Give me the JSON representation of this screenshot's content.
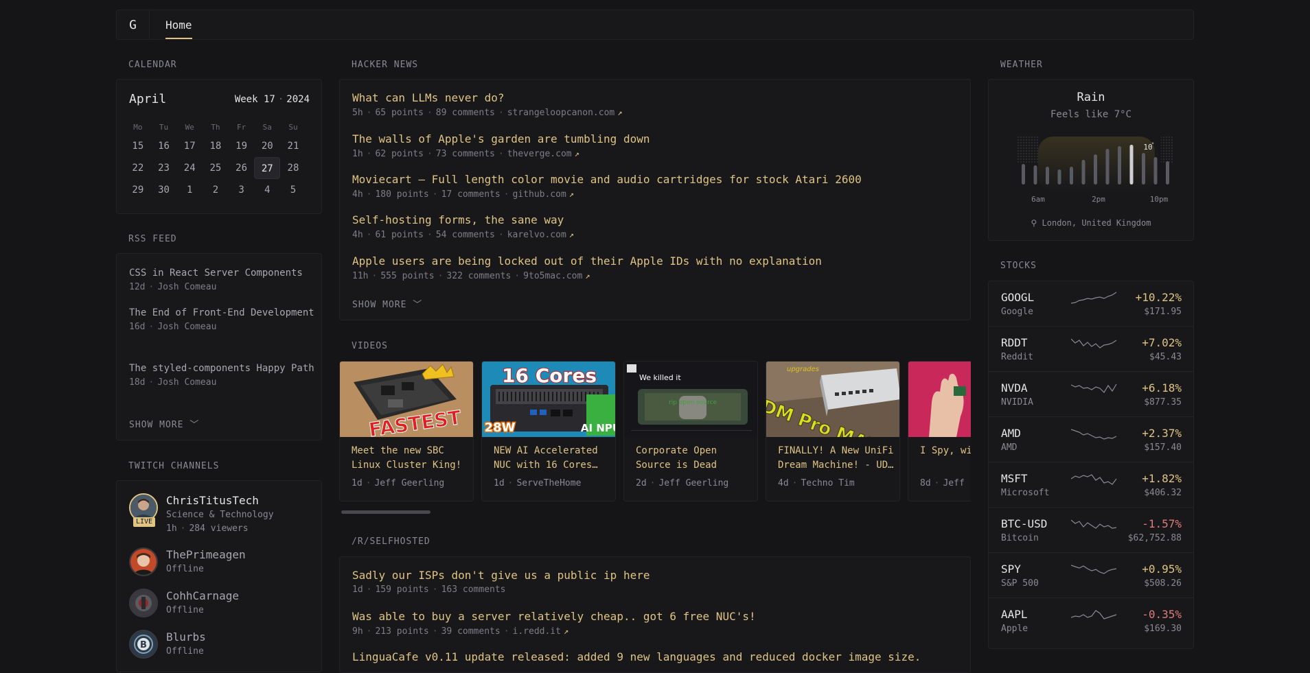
{
  "nav": {
    "logo": "G",
    "home": "Home"
  },
  "calendar": {
    "section": "CALENDAR",
    "month": "April",
    "week_label": "Week 17",
    "year": "2024",
    "weekdays": [
      "Mo",
      "Tu",
      "We",
      "Th",
      "Fr",
      "Sa",
      "Su"
    ],
    "days": [
      "15",
      "16",
      "17",
      "18",
      "19",
      "20",
      "21",
      "22",
      "23",
      "24",
      "25",
      "26",
      "27",
      "28",
      "29",
      "30",
      "1",
      "2",
      "3",
      "4",
      "5"
    ],
    "today": "27"
  },
  "rss": {
    "section": "RSS FEED",
    "items": [
      {
        "title": "CSS in React Server Components",
        "age": "12d",
        "author": "Josh Comeau"
      },
      {
        "title": "The End of Front-End Development",
        "age": "16d",
        "author": "Josh Comeau"
      },
      {
        "title": "The styled-components Happy Path",
        "age": "18d",
        "author": "Josh Comeau"
      }
    ],
    "show_more": "SHOW MORE"
  },
  "twitch": {
    "section": "TWITCH CHANNELS",
    "channels": [
      {
        "name": "ChrisTitusTech",
        "category": "Science & Technology",
        "age": "1h",
        "viewers": "284 viewers",
        "live_badge": "LIVE"
      },
      {
        "name": "ThePrimeagen",
        "status": "Offline"
      },
      {
        "name": "CohhCarnage",
        "status": "Offline"
      },
      {
        "name": "Blurbs",
        "status": "Offline"
      }
    ]
  },
  "hn": {
    "section": "HACKER NEWS",
    "items": [
      {
        "title": "What can LLMs never do?",
        "age": "5h",
        "points": "65 points",
        "comments": "89 comments",
        "domain": "strangeloopcanon.com"
      },
      {
        "title": "The walls of Apple's garden are tumbling down",
        "age": "1h",
        "points": "62 points",
        "comments": "73 comments",
        "domain": "theverge.com"
      },
      {
        "title": "Moviecart – Full length color movie and audio cartridges for stock Atari 2600",
        "age": "4h",
        "points": "180 points",
        "comments": "17 comments",
        "domain": "github.com"
      },
      {
        "title": "Self-hosting forms, the sane way",
        "age": "4h",
        "points": "61 points",
        "comments": "54 comments",
        "domain": "karelvo.com"
      },
      {
        "title": "Apple users are being locked out of their Apple IDs with no explanation",
        "age": "11h",
        "points": "555 points",
        "comments": "322 comments",
        "domain": "9to5mac.com"
      }
    ],
    "show_more": "SHOW MORE"
  },
  "videos": {
    "section": "VIDEOS",
    "items": [
      {
        "title": "Meet the new SBC Linux Cluster King!",
        "age": "1d",
        "channel": "Jeff Geerling",
        "thumb_text": "FASTEST"
      },
      {
        "title": "NEW AI Accelerated NUC with 16 Cores…",
        "age": "1d",
        "channel": "ServeTheHome",
        "thumb_text": "16 Cores",
        "thumb_text2": "28W",
        "thumb_text3": "AI NPU"
      },
      {
        "title": "Corporate Open Source is Dead",
        "age": "2d",
        "channel": "Jeff Geerling",
        "thumb_text": "We killed it",
        "thumb_text2": "rip open source"
      },
      {
        "title": "FINALLY! A New UniFi Dream Machine! - UD…",
        "age": "4d",
        "channel": "Techno Tim",
        "thumb_text": "UDM Pro MAX",
        "thumb_text2": "upgrades"
      },
      {
        "title": "I Spy, wi Little Pi",
        "age": "8d",
        "channel": "Jeff"
      }
    ]
  },
  "selfhosted": {
    "section": "/R/SELFHOSTED",
    "items": [
      {
        "title": "Sadly our ISPs don't give us a public ip here",
        "age": "1d",
        "points": "159 points",
        "comments": "163 comments"
      },
      {
        "title": "Was able to buy a server relatively cheap.. got 6 free NUC's!",
        "age": "9h",
        "points": "213 points",
        "comments": "39 comments",
        "domain": "i.redd.it"
      },
      {
        "title": "LinguaCafe v0.11 update released: added 9 new languages and reduced docker image size."
      }
    ]
  },
  "weather": {
    "section": "WEATHER",
    "condition": "Rain",
    "feels_like": "Feels like 7°C",
    "current_temp": "10",
    "labels": [
      "6am",
      "2pm",
      "10pm"
    ],
    "location": "London, United Kingdom"
  },
  "stocks": {
    "section": "STOCKS",
    "items": [
      {
        "symbol": "GOOGL",
        "name": "Google",
        "change": "+10.22%",
        "price": "$171.95",
        "dir": "up"
      },
      {
        "symbol": "RDDT",
        "name": "Reddit",
        "change": "+7.02%",
        "price": "$45.43",
        "dir": "up"
      },
      {
        "symbol": "NVDA",
        "name": "NVIDIA",
        "change": "+6.18%",
        "price": "$877.35",
        "dir": "up"
      },
      {
        "symbol": "AMD",
        "name": "AMD",
        "change": "+2.37%",
        "price": "$157.40",
        "dir": "up"
      },
      {
        "symbol": "MSFT",
        "name": "Microsoft",
        "change": "+1.82%",
        "price": "$406.32",
        "dir": "up"
      },
      {
        "symbol": "BTC-USD",
        "name": "Bitcoin",
        "change": "-1.57%",
        "price": "$62,752.88",
        "dir": "down"
      },
      {
        "symbol": "SPY",
        "name": "S&P 500",
        "change": "+0.95%",
        "price": "$508.26",
        "dir": "up"
      },
      {
        "symbol": "AAPL",
        "name": "Apple",
        "change": "-0.35%",
        "price": "$169.30",
        "dir": "down"
      }
    ]
  }
}
